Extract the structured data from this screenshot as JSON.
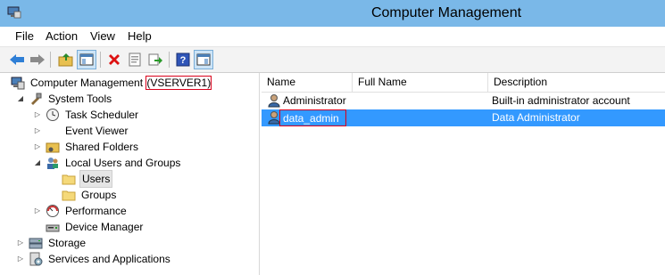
{
  "window": {
    "title": "Computer Management"
  },
  "menu": [
    "File",
    "Action",
    "View",
    "Help"
  ],
  "toolbar": {
    "icons": [
      "back-arrow-icon",
      "forward-arrow-icon",
      "up-folder-icon",
      "show-hide-tree-icon",
      "delete-icon",
      "properties-icon",
      "export-list-icon",
      "help-icon",
      "show-hide-action-pane-icon"
    ]
  },
  "tree": {
    "root_label": "Computer Management",
    "root_server": "(VSERVER1)",
    "system_tools": "System Tools",
    "task_scheduler": "Task Scheduler",
    "event_viewer": "Event Viewer",
    "shared_folders": "Shared Folders",
    "local_users_groups": "Local Users and Groups",
    "users": "Users",
    "groups": "Groups",
    "performance": "Performance",
    "device_manager": "Device Manager",
    "storage": "Storage",
    "services_apps": "Services and Applications"
  },
  "list": {
    "columns": {
      "name": "Name",
      "full_name": "Full Name",
      "description": "Description"
    },
    "rows": [
      {
        "name": "Administrator",
        "full_name": "",
        "description": "Built-in administrator account"
      },
      {
        "name": "data_admin",
        "full_name": "",
        "description": "Data Administrator"
      }
    ]
  },
  "colors": {
    "titlebar": "#7ab8e8",
    "selection": "#3399ff",
    "highlight_box": "#d9001b"
  }
}
